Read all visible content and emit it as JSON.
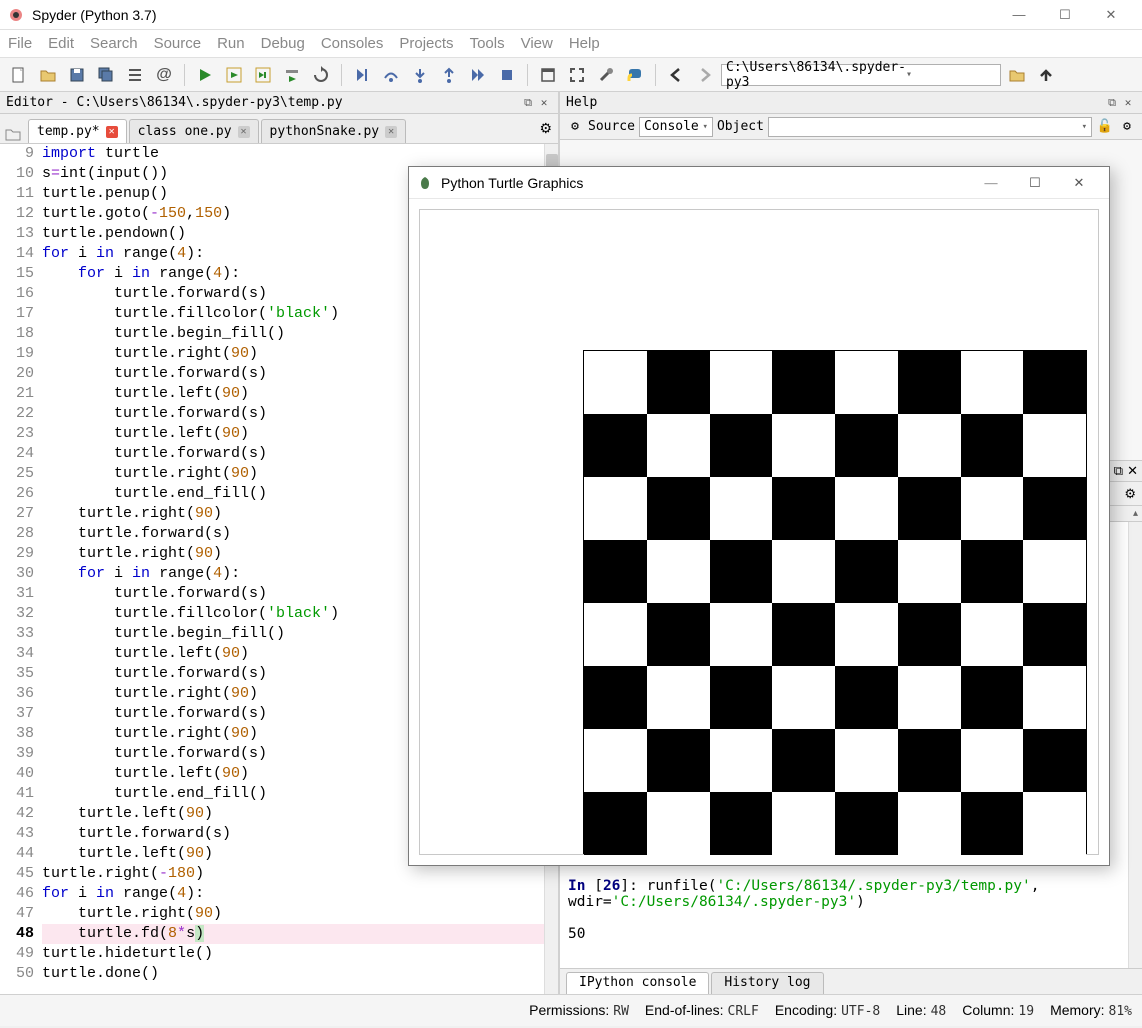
{
  "window": {
    "title": "Spyder (Python 3.7)"
  },
  "menu": [
    "File",
    "Edit",
    "Search",
    "Source",
    "Run",
    "Debug",
    "Consoles",
    "Projects",
    "Tools",
    "View",
    "Help"
  ],
  "toolbar": {
    "workingDir": "C:\\Users\\86134\\.spyder-py3"
  },
  "editorPane": {
    "header": "Editor - C:\\Users\\86134\\.spyder-py3\\temp.py",
    "tabs": [
      {
        "name": "temp.py*",
        "modified": true,
        "active": true
      },
      {
        "name": "class one.py",
        "modified": false,
        "active": false
      },
      {
        "name": "pythonSnake.py",
        "modified": false,
        "active": false
      }
    ],
    "firstLine": 9,
    "currentLine": 48,
    "code": [
      {
        "tokens": [
          {
            "t": "import ",
            "c": "kw"
          },
          {
            "t": "turtle"
          }
        ]
      },
      {
        "tokens": [
          {
            "t": "s"
          },
          {
            "t": "=",
            "c": "op"
          },
          {
            "t": "int"
          },
          {
            "t": "("
          },
          {
            "t": "input"
          },
          {
            "t": "())"
          }
        ]
      },
      {
        "tokens": [
          {
            "t": "turtle.penup()"
          }
        ]
      },
      {
        "tokens": [
          {
            "t": "turtle.goto("
          },
          {
            "t": "-",
            "c": "op"
          },
          {
            "t": "150",
            "c": "num"
          },
          {
            "t": ","
          },
          {
            "t": "150",
            "c": "num"
          },
          {
            "t": ")"
          }
        ]
      },
      {
        "tokens": [
          {
            "t": "turtle.pendown()"
          }
        ]
      },
      {
        "tokens": [
          {
            "t": "for ",
            "c": "kw"
          },
          {
            "t": "i "
          },
          {
            "t": "in ",
            "c": "kw"
          },
          {
            "t": "range"
          },
          {
            "t": "("
          },
          {
            "t": "4",
            "c": "num"
          },
          {
            "t": "):"
          }
        ]
      },
      {
        "tokens": [
          {
            "t": "    "
          },
          {
            "t": "for ",
            "c": "kw"
          },
          {
            "t": "i "
          },
          {
            "t": "in ",
            "c": "kw"
          },
          {
            "t": "range"
          },
          {
            "t": "("
          },
          {
            "t": "4",
            "c": "num"
          },
          {
            "t": "):"
          }
        ]
      },
      {
        "tokens": [
          {
            "t": "        turtle.forward(s)"
          }
        ]
      },
      {
        "tokens": [
          {
            "t": "        turtle.fillcolor("
          },
          {
            "t": "'black'",
            "c": "str"
          },
          {
            "t": ")"
          }
        ]
      },
      {
        "tokens": [
          {
            "t": "        turtle.begin_fill()"
          }
        ]
      },
      {
        "tokens": [
          {
            "t": "        turtle.right("
          },
          {
            "t": "90",
            "c": "num"
          },
          {
            "t": ")"
          }
        ]
      },
      {
        "tokens": [
          {
            "t": "        turtle.forward(s)"
          }
        ]
      },
      {
        "tokens": [
          {
            "t": "        turtle.left("
          },
          {
            "t": "90",
            "c": "num"
          },
          {
            "t": ")"
          }
        ]
      },
      {
        "tokens": [
          {
            "t": "        turtle.forward(s)"
          }
        ]
      },
      {
        "tokens": [
          {
            "t": "        turtle.left("
          },
          {
            "t": "90",
            "c": "num"
          },
          {
            "t": ")"
          }
        ]
      },
      {
        "tokens": [
          {
            "t": "        turtle.forward(s)"
          }
        ]
      },
      {
        "tokens": [
          {
            "t": "        turtle.right("
          },
          {
            "t": "90",
            "c": "num"
          },
          {
            "t": ")"
          }
        ]
      },
      {
        "tokens": [
          {
            "t": "        turtle.end_fill()"
          }
        ]
      },
      {
        "tokens": [
          {
            "t": "    turtle.right("
          },
          {
            "t": "90",
            "c": "num"
          },
          {
            "t": ")"
          }
        ]
      },
      {
        "tokens": [
          {
            "t": "    turtle.forward(s)"
          }
        ]
      },
      {
        "tokens": [
          {
            "t": "    turtle.right("
          },
          {
            "t": "90",
            "c": "num"
          },
          {
            "t": ")"
          }
        ]
      },
      {
        "tokens": [
          {
            "t": "    "
          },
          {
            "t": "for ",
            "c": "kw"
          },
          {
            "t": "i "
          },
          {
            "t": "in ",
            "c": "kw"
          },
          {
            "t": "range"
          },
          {
            "t": "("
          },
          {
            "t": "4",
            "c": "num"
          },
          {
            "t": "):"
          }
        ]
      },
      {
        "tokens": [
          {
            "t": "        turtle.forward(s)"
          }
        ]
      },
      {
        "tokens": [
          {
            "t": "        turtle.fillcolor("
          },
          {
            "t": "'black'",
            "c": "str"
          },
          {
            "t": ")"
          }
        ]
      },
      {
        "tokens": [
          {
            "t": "        turtle.begin_fill()"
          }
        ]
      },
      {
        "tokens": [
          {
            "t": "        turtle.left("
          },
          {
            "t": "90",
            "c": "num"
          },
          {
            "t": ")"
          }
        ]
      },
      {
        "tokens": [
          {
            "t": "        turtle.forward(s)"
          }
        ]
      },
      {
        "tokens": [
          {
            "t": "        turtle.right("
          },
          {
            "t": "90",
            "c": "num"
          },
          {
            "t": ")"
          }
        ]
      },
      {
        "tokens": [
          {
            "t": "        turtle.forward(s)"
          }
        ]
      },
      {
        "tokens": [
          {
            "t": "        turtle.right("
          },
          {
            "t": "90",
            "c": "num"
          },
          {
            "t": ")"
          }
        ]
      },
      {
        "tokens": [
          {
            "t": "        turtle.forward(s)"
          }
        ]
      },
      {
        "tokens": [
          {
            "t": "        turtle.left("
          },
          {
            "t": "90",
            "c": "num"
          },
          {
            "t": ")"
          }
        ]
      },
      {
        "tokens": [
          {
            "t": "        turtle.end_fill()"
          }
        ]
      },
      {
        "tokens": [
          {
            "t": "    turtle.left("
          },
          {
            "t": "90",
            "c": "num"
          },
          {
            "t": ")"
          }
        ]
      },
      {
        "tokens": [
          {
            "t": "    turtle.forward(s)"
          }
        ]
      },
      {
        "tokens": [
          {
            "t": "    turtle.left("
          },
          {
            "t": "90",
            "c": "num"
          },
          {
            "t": ")"
          }
        ]
      },
      {
        "tokens": [
          {
            "t": "turtle.right("
          },
          {
            "t": "-",
            "c": "op"
          },
          {
            "t": "180",
            "c": "num"
          },
          {
            "t": ")"
          }
        ]
      },
      {
        "tokens": [
          {
            "t": "for ",
            "c": "kw"
          },
          {
            "t": "i "
          },
          {
            "t": "in ",
            "c": "kw"
          },
          {
            "t": "range"
          },
          {
            "t": "("
          },
          {
            "t": "4",
            "c": "num"
          },
          {
            "t": "):"
          }
        ]
      },
      {
        "tokens": [
          {
            "t": "    turtle.right("
          },
          {
            "t": "90",
            "c": "num"
          },
          {
            "t": ")"
          }
        ]
      },
      {
        "tokens": [
          {
            "t": "    turtle.fd("
          },
          {
            "t": "8",
            "c": "num"
          },
          {
            "t": "*",
            "c": "op"
          },
          {
            "t": "s"
          },
          {
            "t": ")",
            "c": "hl"
          }
        ]
      },
      {
        "tokens": [
          {
            "t": "turtle.hideturtle()"
          }
        ]
      },
      {
        "tokens": [
          {
            "t": "turtle.done()"
          }
        ]
      }
    ]
  },
  "helpPane": {
    "header": "Help",
    "sourceLabel": "Source",
    "sourceValue": "Console",
    "objectLabel": "Object"
  },
  "turtle": {
    "title": "Python Turtle Graphics",
    "boardSize": 8
  },
  "consolePane": {
    "inLabel": "In ",
    "inNum": "26",
    "cmd1": "runfile(",
    "path1": "'C:/Users/86134/.spyder-py3/temp.py'",
    "cmd2": ", wdir=",
    "path2": "'C:/Users/86134/.spyder-py3'",
    "cmd3": ")",
    "output": "50",
    "tabs": [
      "IPython console",
      "History log"
    ]
  },
  "status": {
    "permLabel": "Permissions:",
    "permVal": "RW",
    "eolLabel": "End-of-lines:",
    "eolVal": "CRLF",
    "encLabel": "Encoding:",
    "encVal": "UTF-8",
    "lineLabel": "Line:",
    "lineVal": "48",
    "colLabel": "Column:",
    "colVal": "19",
    "memLabel": "Memory:",
    "memVal": "81%"
  }
}
